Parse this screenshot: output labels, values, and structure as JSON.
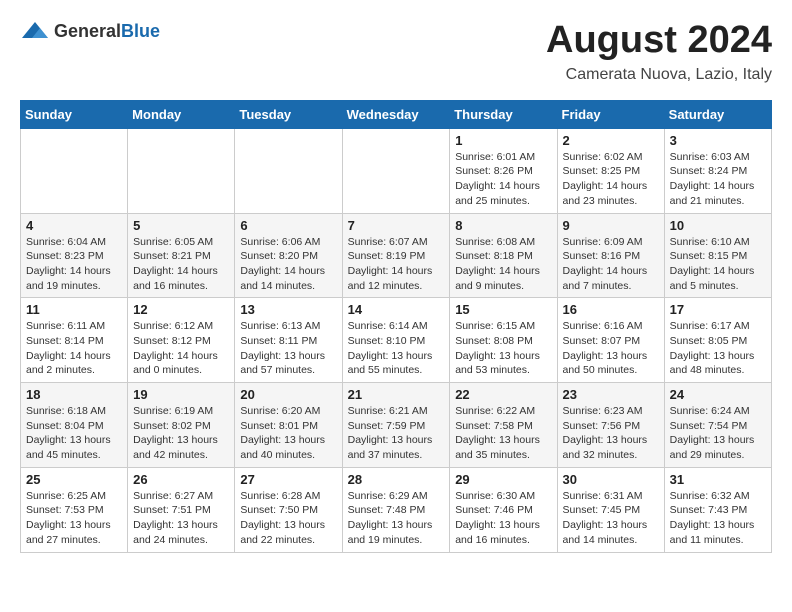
{
  "logo": {
    "general": "General",
    "blue": "Blue"
  },
  "header": {
    "month_year": "August 2024",
    "location": "Camerata Nuova, Lazio, Italy"
  },
  "weekdays": [
    "Sunday",
    "Monday",
    "Tuesday",
    "Wednesday",
    "Thursday",
    "Friday",
    "Saturday"
  ],
  "weeks": [
    [
      {
        "day": "",
        "info": ""
      },
      {
        "day": "",
        "info": ""
      },
      {
        "day": "",
        "info": ""
      },
      {
        "day": "",
        "info": ""
      },
      {
        "day": "1",
        "info": "Sunrise: 6:01 AM\nSunset: 8:26 PM\nDaylight: 14 hours\nand 25 minutes."
      },
      {
        "day": "2",
        "info": "Sunrise: 6:02 AM\nSunset: 8:25 PM\nDaylight: 14 hours\nand 23 minutes."
      },
      {
        "day": "3",
        "info": "Sunrise: 6:03 AM\nSunset: 8:24 PM\nDaylight: 14 hours\nand 21 minutes."
      }
    ],
    [
      {
        "day": "4",
        "info": "Sunrise: 6:04 AM\nSunset: 8:23 PM\nDaylight: 14 hours\nand 19 minutes."
      },
      {
        "day": "5",
        "info": "Sunrise: 6:05 AM\nSunset: 8:21 PM\nDaylight: 14 hours\nand 16 minutes."
      },
      {
        "day": "6",
        "info": "Sunrise: 6:06 AM\nSunset: 8:20 PM\nDaylight: 14 hours\nand 14 minutes."
      },
      {
        "day": "7",
        "info": "Sunrise: 6:07 AM\nSunset: 8:19 PM\nDaylight: 14 hours\nand 12 minutes."
      },
      {
        "day": "8",
        "info": "Sunrise: 6:08 AM\nSunset: 8:18 PM\nDaylight: 14 hours\nand 9 minutes."
      },
      {
        "day": "9",
        "info": "Sunrise: 6:09 AM\nSunset: 8:16 PM\nDaylight: 14 hours\nand 7 minutes."
      },
      {
        "day": "10",
        "info": "Sunrise: 6:10 AM\nSunset: 8:15 PM\nDaylight: 14 hours\nand 5 minutes."
      }
    ],
    [
      {
        "day": "11",
        "info": "Sunrise: 6:11 AM\nSunset: 8:14 PM\nDaylight: 14 hours\nand 2 minutes."
      },
      {
        "day": "12",
        "info": "Sunrise: 6:12 AM\nSunset: 8:12 PM\nDaylight: 14 hours\nand 0 minutes."
      },
      {
        "day": "13",
        "info": "Sunrise: 6:13 AM\nSunset: 8:11 PM\nDaylight: 13 hours\nand 57 minutes."
      },
      {
        "day": "14",
        "info": "Sunrise: 6:14 AM\nSunset: 8:10 PM\nDaylight: 13 hours\nand 55 minutes."
      },
      {
        "day": "15",
        "info": "Sunrise: 6:15 AM\nSunset: 8:08 PM\nDaylight: 13 hours\nand 53 minutes."
      },
      {
        "day": "16",
        "info": "Sunrise: 6:16 AM\nSunset: 8:07 PM\nDaylight: 13 hours\nand 50 minutes."
      },
      {
        "day": "17",
        "info": "Sunrise: 6:17 AM\nSunset: 8:05 PM\nDaylight: 13 hours\nand 48 minutes."
      }
    ],
    [
      {
        "day": "18",
        "info": "Sunrise: 6:18 AM\nSunset: 8:04 PM\nDaylight: 13 hours\nand 45 minutes."
      },
      {
        "day": "19",
        "info": "Sunrise: 6:19 AM\nSunset: 8:02 PM\nDaylight: 13 hours\nand 42 minutes."
      },
      {
        "day": "20",
        "info": "Sunrise: 6:20 AM\nSunset: 8:01 PM\nDaylight: 13 hours\nand 40 minutes."
      },
      {
        "day": "21",
        "info": "Sunrise: 6:21 AM\nSunset: 7:59 PM\nDaylight: 13 hours\nand 37 minutes."
      },
      {
        "day": "22",
        "info": "Sunrise: 6:22 AM\nSunset: 7:58 PM\nDaylight: 13 hours\nand 35 minutes."
      },
      {
        "day": "23",
        "info": "Sunrise: 6:23 AM\nSunset: 7:56 PM\nDaylight: 13 hours\nand 32 minutes."
      },
      {
        "day": "24",
        "info": "Sunrise: 6:24 AM\nSunset: 7:54 PM\nDaylight: 13 hours\nand 29 minutes."
      }
    ],
    [
      {
        "day": "25",
        "info": "Sunrise: 6:25 AM\nSunset: 7:53 PM\nDaylight: 13 hours\nand 27 minutes."
      },
      {
        "day": "26",
        "info": "Sunrise: 6:27 AM\nSunset: 7:51 PM\nDaylight: 13 hours\nand 24 minutes."
      },
      {
        "day": "27",
        "info": "Sunrise: 6:28 AM\nSunset: 7:50 PM\nDaylight: 13 hours\nand 22 minutes."
      },
      {
        "day": "28",
        "info": "Sunrise: 6:29 AM\nSunset: 7:48 PM\nDaylight: 13 hours\nand 19 minutes."
      },
      {
        "day": "29",
        "info": "Sunrise: 6:30 AM\nSunset: 7:46 PM\nDaylight: 13 hours\nand 16 minutes."
      },
      {
        "day": "30",
        "info": "Sunrise: 6:31 AM\nSunset: 7:45 PM\nDaylight: 13 hours\nand 14 minutes."
      },
      {
        "day": "31",
        "info": "Sunrise: 6:32 AM\nSunset: 7:43 PM\nDaylight: 13 hours\nand 11 minutes."
      }
    ]
  ]
}
